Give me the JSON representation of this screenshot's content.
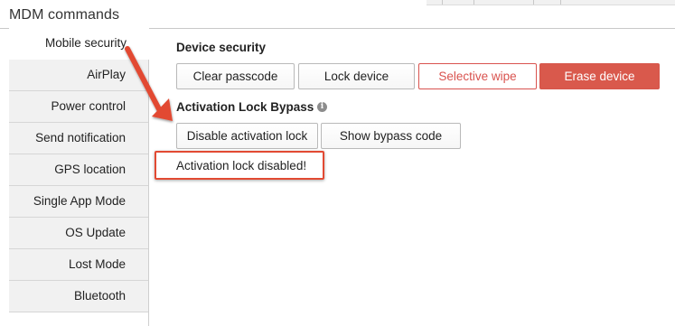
{
  "header": {
    "title": "MDM commands"
  },
  "sidebar": {
    "items": [
      {
        "label": "Mobile security"
      },
      {
        "label": "AirPlay"
      },
      {
        "label": "Power control"
      },
      {
        "label": "Send notification"
      },
      {
        "label": "GPS location"
      },
      {
        "label": "Single App Mode"
      },
      {
        "label": "OS Update"
      },
      {
        "label": "Lost Mode"
      },
      {
        "label": "Bluetooth"
      }
    ]
  },
  "device_security": {
    "title": "Device security",
    "buttons": {
      "clear_passcode": "Clear passcode",
      "lock_device": "Lock device",
      "selective_wipe": "Selective wipe",
      "erase_device": "Erase device"
    }
  },
  "activation_lock": {
    "title": "Activation Lock Bypass",
    "info_icon": "info-icon",
    "buttons": {
      "disable": "Disable activation lock",
      "show_code": "Show bypass code"
    },
    "status": "Activation lock disabled!"
  },
  "colors": {
    "danger": "#d9594c",
    "annotation": "#e24a33"
  }
}
